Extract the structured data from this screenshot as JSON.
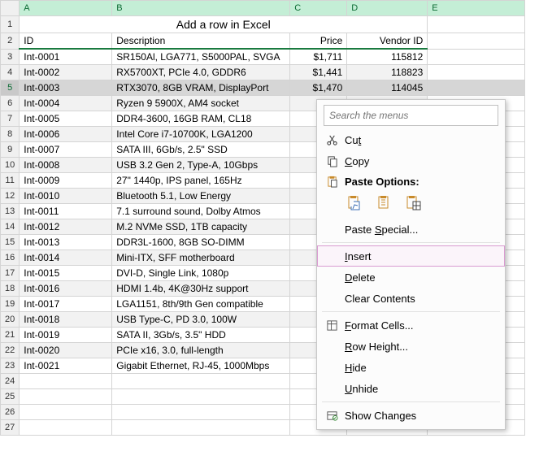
{
  "title": "Add a row in Excel",
  "columns_letters": [
    "A",
    "B",
    "C",
    "D",
    "E"
  ],
  "headers": {
    "A": "ID",
    "B": "Description",
    "C": "Price",
    "D": "Vendor ID"
  },
  "selected_row": 5,
  "rows": [
    {
      "id": "Int-0001",
      "desc": "SR150Al, LGA771, S5000PAL, SVGA",
      "price": "$1,711",
      "vendor": "115812"
    },
    {
      "id": "Int-0002",
      "desc": "RX5700XT, PCIe 4.0, GDDR6",
      "price": "$1,441",
      "vendor": "118823"
    },
    {
      "id": "Int-0003",
      "desc": "RTX3070, 8GB VRAM, DisplayPort",
      "price": "$1,470",
      "vendor": "114045"
    },
    {
      "id": "Int-0004",
      "desc": "Ryzen 9 5900X, AM4 socket",
      "price": "",
      "vendor": ""
    },
    {
      "id": "Int-0005",
      "desc": "DDR4-3600, 16GB RAM, CL18",
      "price": "",
      "vendor": ""
    },
    {
      "id": "Int-0006",
      "desc": "Intel Core i7-10700K, LGA1200",
      "price": "",
      "vendor": ""
    },
    {
      "id": "Int-0007",
      "desc": "SATA III, 6Gb/s, 2.5\" SSD",
      "price": "",
      "vendor": ""
    },
    {
      "id": "Int-0008",
      "desc": "USB 3.2 Gen 2, Type-A, 10Gbps",
      "price": "",
      "vendor": ""
    },
    {
      "id": "Int-0009",
      "desc": "27\" 1440p, IPS panel, 165Hz",
      "price": "",
      "vendor": ""
    },
    {
      "id": "Int-0010",
      "desc": "Bluetooth 5.1, Low Energy",
      "price": "",
      "vendor": ""
    },
    {
      "id": "Int-0011",
      "desc": "7.1 surround sound, Dolby Atmos",
      "price": "",
      "vendor": ""
    },
    {
      "id": "Int-0012",
      "desc": "M.2 NVMe SSD, 1TB capacity",
      "price": "",
      "vendor": ""
    },
    {
      "id": "Int-0013",
      "desc": "DDR3L-1600, 8GB SO-DIMM",
      "price": "",
      "vendor": ""
    },
    {
      "id": "Int-0014",
      "desc": "Mini-ITX, SFF motherboard",
      "price": "",
      "vendor": ""
    },
    {
      "id": "Int-0015",
      "desc": "DVI-D, Single Link, 1080p",
      "price": "",
      "vendor": ""
    },
    {
      "id": "Int-0016",
      "desc": "HDMI 1.4b, 4K@30Hz support",
      "price": "",
      "vendor": ""
    },
    {
      "id": "Int-0017",
      "desc": "LGA1151, 8th/9th Gen compatible",
      "price": "",
      "vendor": ""
    },
    {
      "id": "Int-0018",
      "desc": "USB Type-C, PD 3.0, 100W",
      "price": "",
      "vendor": ""
    },
    {
      "id": "Int-0019",
      "desc": "SATA II, 3Gb/s, 3.5\" HDD",
      "price": "",
      "vendor": ""
    },
    {
      "id": "Int-0020",
      "desc": "PCIe x16, 3.0, full-length",
      "price": "",
      "vendor": ""
    },
    {
      "id": "Int-0021",
      "desc": "Gigabit Ethernet, RJ-45, 1000Mbps",
      "price": "",
      "vendor": ""
    }
  ],
  "empty_rows_after": 4,
  "context_menu": {
    "search_placeholder": "Search the menus",
    "cut": "Cut",
    "copy": "Copy",
    "paste_options": "Paste Options:",
    "paste_special": "Paste Special...",
    "insert": "Insert",
    "delete": "Delete",
    "clear": "Clear Contents",
    "format_cells": "Format Cells...",
    "row_height": "Row Height...",
    "hide": "Hide",
    "unhide": "Unhide",
    "show_changes": "Show Changes"
  }
}
